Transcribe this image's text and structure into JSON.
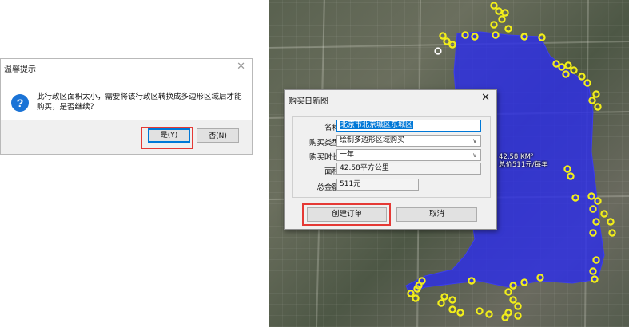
{
  "message_box": {
    "title": "温馨提示",
    "icon": "question-icon",
    "text": "此行政区面积太小，需要将该行政区转换成多边形区域后才能购买，是否继续？",
    "yes_label": "是(Y)",
    "no_label": "否(N)"
  },
  "map": {
    "overlay_color": "#2d2ee8",
    "marker_color": "#f2ee1a",
    "area_label_line1": "42.58 KM²",
    "area_label_line2": "总价511元/每年"
  },
  "dialog": {
    "title": "购买日新图",
    "fields": {
      "name_label": "名称",
      "name_value": "北京市北京城区东城区",
      "type_label": "购买类型",
      "type_value": "绘制多边形区域购买",
      "duration_label": "购买时长",
      "duration_value": "一年",
      "area_label": "面积",
      "area_value": "42.58平方公里",
      "amount_label": "总金额",
      "amount_value": "511元"
    },
    "create_order_label": "创建订单",
    "cancel_label": "取消"
  },
  "highlight_color": "#e53935"
}
